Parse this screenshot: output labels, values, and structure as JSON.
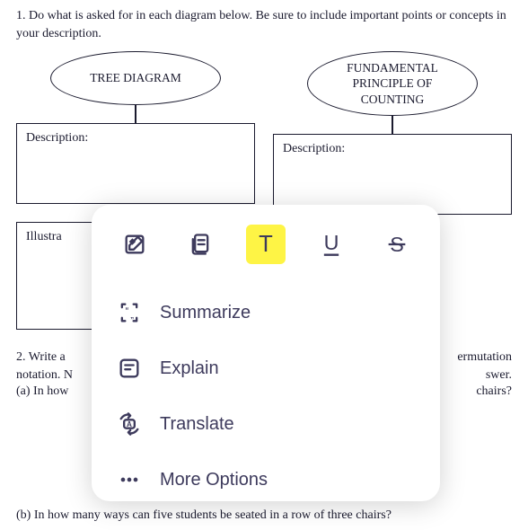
{
  "question1": "1. Do what is asked for in each diagram below. Be sure to include important points or concepts in your description.",
  "diagrams": {
    "left": {
      "title": "TREE DIAGRAM",
      "description_label": "Description:",
      "illustration_label": "Illustra"
    },
    "right": {
      "title": "FUNDAMENTAL PRINCIPLE OF COUNTING",
      "description_label": "Description:"
    }
  },
  "question2_line1": "2. Write a",
  "question2_line2": "notation. N",
  "question2a": "(a) In how",
  "question2_right1": "ermutation",
  "question2_right2": "swer.",
  "question2a_right": "chairs?",
  "question2b": "(b) In how many ways can five students be seated in a row of three chairs?",
  "popup": {
    "toolbar": {
      "edit": "edit-icon",
      "copy": "copy-icon",
      "highlight": "highlight-icon",
      "underline": "underline-icon",
      "strikethrough": "strikethrough-icon"
    },
    "menu": {
      "summarize": "Summarize",
      "explain": "Explain",
      "translate": "Translate",
      "more": "More Options"
    }
  }
}
